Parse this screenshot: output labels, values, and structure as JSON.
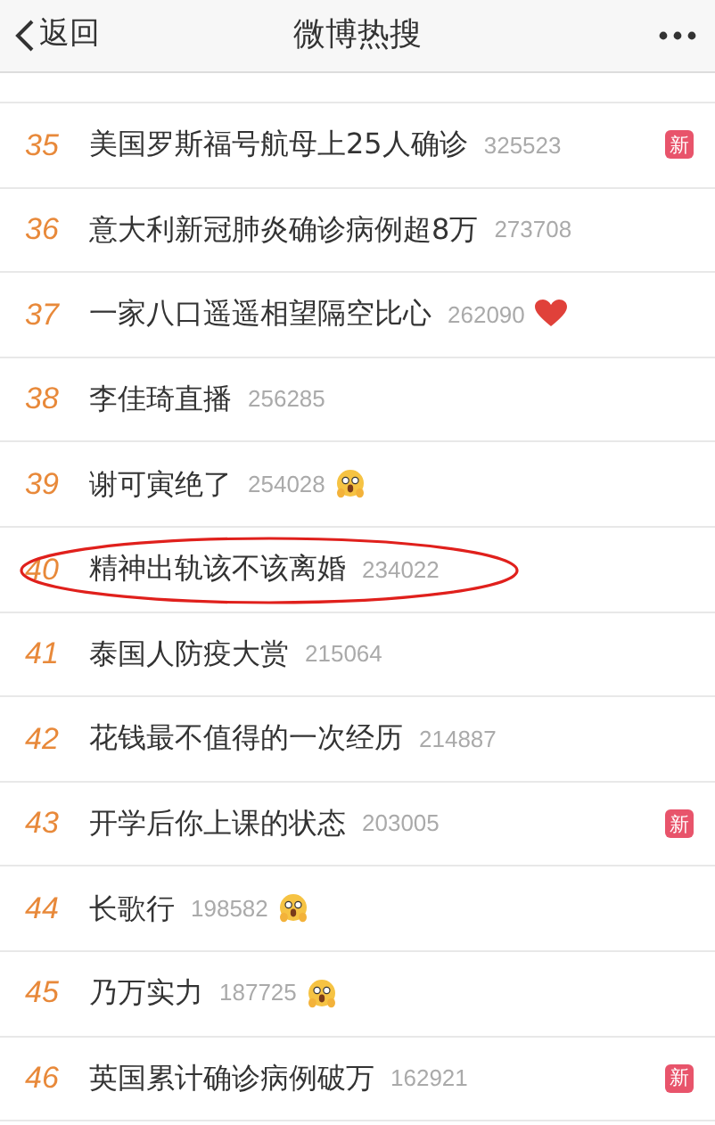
{
  "header": {
    "back_label": "返回",
    "title": "微博热搜"
  },
  "rows": [
    {
      "rank": "35",
      "title": "美国罗斯福号航母上25人确诊",
      "count": "325523",
      "badge": "新",
      "circled": false
    },
    {
      "rank": "36",
      "title": "意大利新冠肺炎确诊病例超8万",
      "count": "273708",
      "circled": false
    },
    {
      "rank": "37",
      "title": "一家八口遥遥相望隔空比心",
      "count": "262090",
      "kind": "heart",
      "circled": false
    },
    {
      "rank": "38",
      "title": "李佳琦直播",
      "count": "256285",
      "circled": false
    },
    {
      "rank": "39",
      "title": "谢可寅绝了",
      "count": "254028",
      "kind": "scared",
      "circled": false
    },
    {
      "rank": "40",
      "title": "精神出轨该不该离婚",
      "count": "234022",
      "circled": true
    },
    {
      "rank": "41",
      "title": "泰国人防疫大赏",
      "count": "215064",
      "circled": false
    },
    {
      "rank": "42",
      "title": "花钱最不值得的一次经历",
      "count": "214887",
      "circled": false
    },
    {
      "rank": "43",
      "title": "开学后你上课的状态",
      "count": "203005",
      "badge": "新",
      "circled": false
    },
    {
      "rank": "44",
      "title": "长歌行",
      "count": "198582",
      "kind": "scared",
      "circled": false
    },
    {
      "rank": "45",
      "title": "乃万实力",
      "count": "187725",
      "kind": "scared",
      "circled": false
    },
    {
      "rank": "46",
      "title": "英国累计确诊病例破万",
      "count": "162921",
      "badge": "新",
      "circled": false
    }
  ]
}
